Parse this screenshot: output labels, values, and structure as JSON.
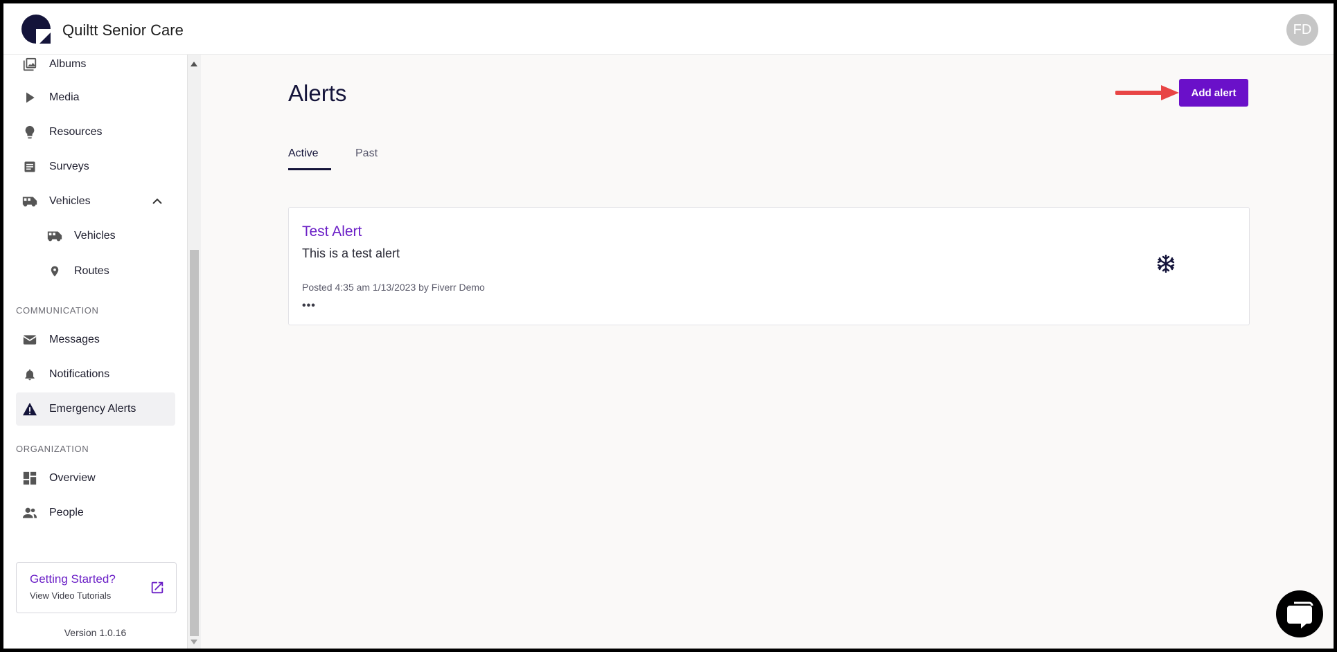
{
  "app": {
    "title": "Quiltt Senior Care",
    "user_initials": "FD"
  },
  "sidebar": {
    "items": [
      {
        "label": "Albums",
        "icon": "image-icon"
      },
      {
        "label": "Media",
        "icon": "play-icon"
      },
      {
        "label": "Resources",
        "icon": "lightbulb-icon"
      },
      {
        "label": "Surveys",
        "icon": "survey-icon"
      },
      {
        "label": "Vehicles",
        "icon": "bus-icon"
      },
      {
        "label": "Vehicles",
        "icon": "bus-icon"
      },
      {
        "label": "Routes",
        "icon": "location-pin-icon"
      },
      {
        "label": "Messages",
        "icon": "envelope-icon"
      },
      {
        "label": "Notifications",
        "icon": "bell-icon"
      },
      {
        "label": "Emergency Alerts",
        "icon": "warning-icon"
      },
      {
        "label": "Overview",
        "icon": "dashboard-icon"
      },
      {
        "label": "People",
        "icon": "people-icon"
      }
    ],
    "sections": {
      "communication": "COMMUNICATION",
      "organization": "ORGANIZATION"
    },
    "help": {
      "title": "Getting Started?",
      "subtitle": "View Video Tutorials"
    },
    "version": "Version 1.0.16"
  },
  "main": {
    "title": "Alerts",
    "add_button": "Add alert",
    "tabs": [
      "Active",
      "Past"
    ],
    "alerts": [
      {
        "title": "Test Alert",
        "description": "This is a test alert",
        "meta": "Posted 4:35 am 1/13/2023 by Fiverr Demo",
        "more": "•••",
        "icon": "snowflake-icon"
      }
    ]
  },
  "colors": {
    "accent": "#6a10c9",
    "annotation_arrow": "#e84545",
    "navy": "#14143a"
  }
}
